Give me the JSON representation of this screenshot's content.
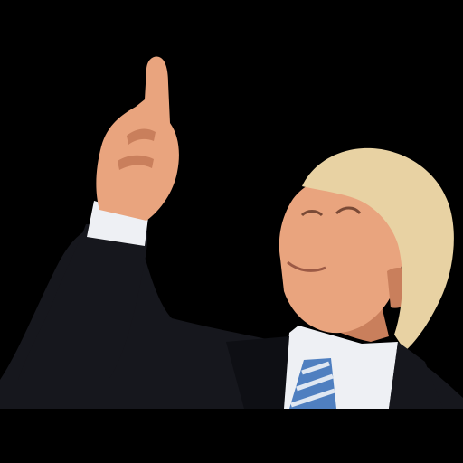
{
  "image": {
    "subject": "",
    "background_color": "#000000",
    "colors": {
      "suit": "#16171d",
      "shirt": "#eef0f4",
      "skin": "#e9a47e",
      "skin_shadow": "#c97f5c",
      "hair": "#e8d2a3",
      "tie": "#4f7fc0",
      "tie_stripe": "#dfe7f2"
    }
  }
}
